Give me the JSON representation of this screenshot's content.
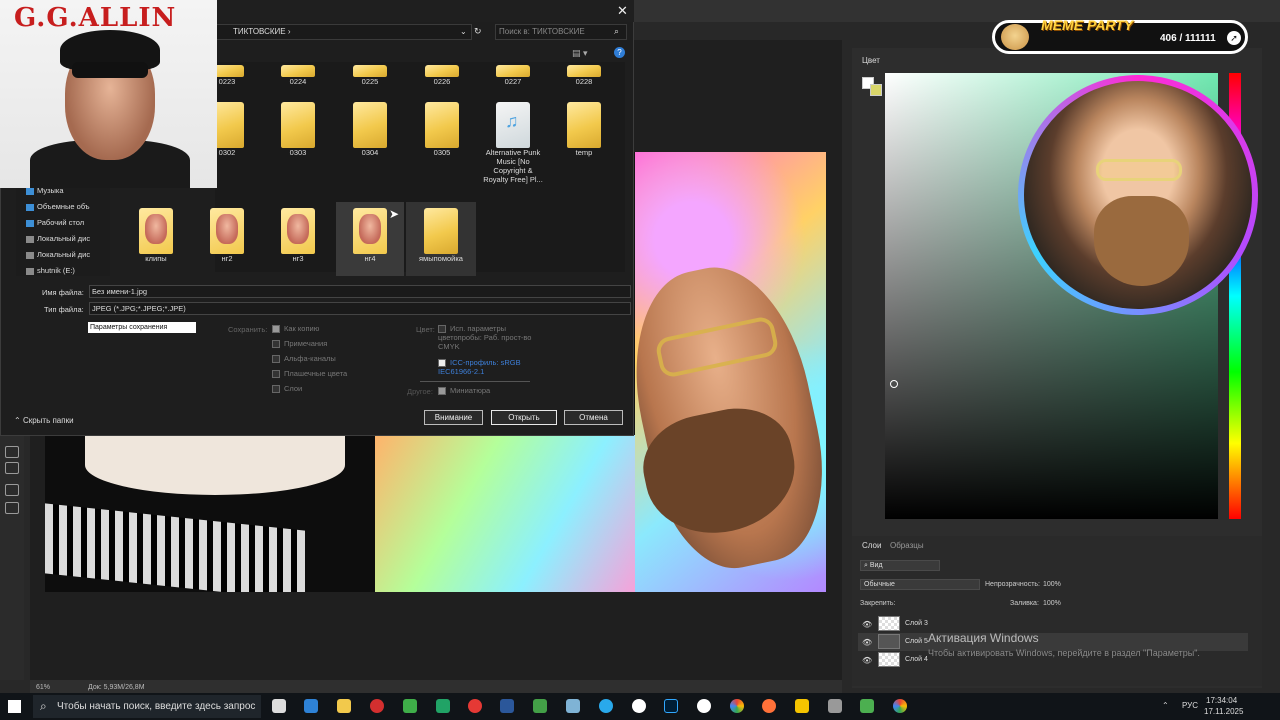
{
  "dialog": {
    "breadcrumb": "ТИКТОВСКИЕ",
    "search_placeholder": "Поиск в: ТИКТОВСКИЕ",
    "folders_row1": [
      "0223",
      "0224",
      "0225",
      "0226",
      "0227",
      "0228"
    ],
    "folders_row2": [
      "0302",
      "0303",
      "0304",
      "0305",
      "Alternative Punk Music [No Copyright & Royalty Free] Pl...",
      "temp"
    ],
    "folders_row3": [
      "клипы",
      "нг2",
      "нг3",
      "нг4",
      "ямыпомойка"
    ],
    "nav_items": [
      "Музыка",
      "Объемные объ",
      "Рабочий стол",
      "Локальный дис",
      "Локальный дис",
      "shutnik (E:)"
    ],
    "filename_label": "Имя файла:",
    "filename_value": "Без имени-1.jpg",
    "filetype_label": "Тип файла:",
    "filetype_value": "JPEG (*.JPG;*.JPEG;*.JPE)",
    "save_options_label": "Параметры сохранения",
    "save_label": "Сохранить:",
    "save_options": [
      "Как копию",
      "Примечания",
      "Альфа-каналы",
      "Плашечные цвета",
      "Слои"
    ],
    "color_label": "Цвет:",
    "color_opt1": "Исп. параметры цветопробы: Раб. прост-во CMYK",
    "color_opt2": "ICC-профиль: sRGB IEC61966-2.1",
    "other_label": "Другое:",
    "other_opt": "Миниатюра",
    "hide_folders": "Скрыть папки",
    "btn_warning": "Внимание",
    "btn_open": "Открыть",
    "btn_cancel": "Отмена"
  },
  "webcam_left": {
    "title": "G.G.ALLIN"
  },
  "meme_banner": {
    "title": "MEME PARTY",
    "count": "406 / 111111"
  },
  "ps": {
    "color_tab": "Цвет",
    "layers_tab": "Слои",
    "swatches_tab": "Образцы",
    "search_kind": "Вид",
    "blend_mode": "Обычные",
    "opacity_label": "Непрозрачность:",
    "opacity_value": "100%",
    "lock_label": "Закрепить:",
    "fill_label": "Заливка:",
    "fill_value": "100%",
    "layers": [
      "Слой 3",
      "Слой 5",
      "Слой 4"
    ],
    "zoom": "61%",
    "doc_info": "Док: 5,93M/26,8M"
  },
  "activation": {
    "title": "Активация Windows",
    "subtitle": "Чтобы активировать Windows, перейдите в раздел \"Параметры\"."
  },
  "taskbar": {
    "search_placeholder": "Чтобы начать поиск, введите здесь запрос",
    "lang": "РУС",
    "time": "17:34:04",
    "date": "17.11.2025"
  },
  "colors": {
    "accent_title": "#c71e1e",
    "folder": "#f2c94c",
    "meme_title": "#ffd23f"
  }
}
